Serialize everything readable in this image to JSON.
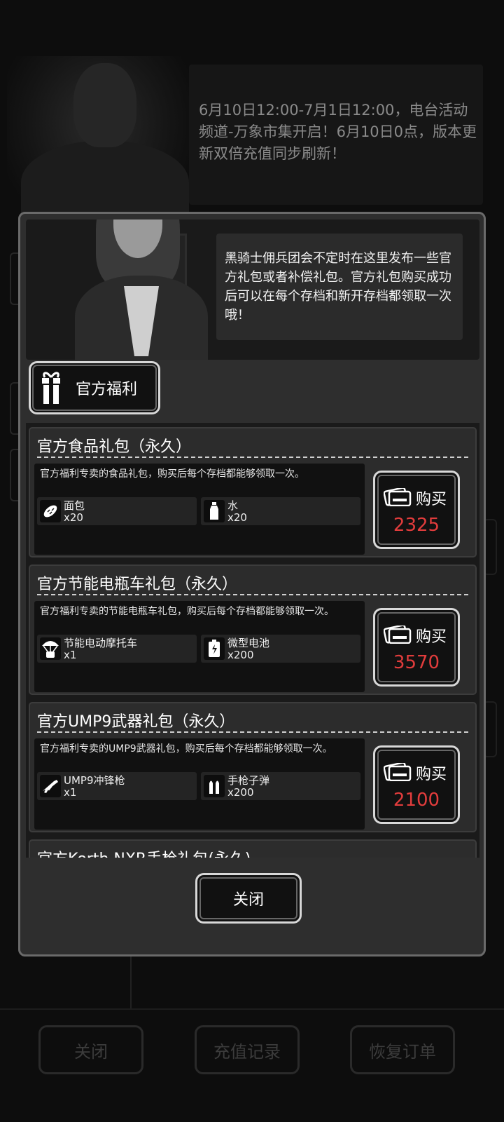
{
  "background": {
    "notice_text": "6月10日12:00-7月1日12:00，电台活动频道-万象市集开启！6月10日0点，版本更新双倍充值同步刷新！",
    "bottom_buttons": [
      {
        "label": "关闭"
      },
      {
        "label": "充值记录"
      },
      {
        "label": "恢复订单"
      }
    ]
  },
  "modal": {
    "intro_text": "黑骑士佣兵团会不定时在这里发布一些官方礼包或者补偿礼包。官方礼包购买成功后可以在每个存档和新开存档都领取一次哦！",
    "tab_label": "官方福利",
    "close_label": "关闭",
    "accent_price_color": "#e13c3c",
    "packs": [
      {
        "title": "官方食品礼包（永久）",
        "desc": "官方福利专卖的食品礼包，购买后每个存档都能够领取一次。",
        "buy_label": "购买",
        "price": "2325",
        "rewards": [
          {
            "icon": "bread-icon",
            "name": "面包",
            "count": "x20"
          },
          {
            "icon": "water-bottle-icon",
            "name": "水",
            "count": "x20"
          }
        ]
      },
      {
        "title": "官方节能电瓶车礼包（永久）",
        "desc": "官方福利专卖的节能电瓶车礼包，购买后每个存档都能够领取一次。",
        "buy_label": "购买",
        "price": "3570",
        "rewards": [
          {
            "icon": "airdrop-scooter-icon",
            "name": "节能电动摩托车",
            "count": "x1"
          },
          {
            "icon": "battery-icon",
            "name": "微型电池",
            "count": "x200"
          }
        ]
      },
      {
        "title": "官方UMP9武器礼包（永久）",
        "desc": "官方福利专卖的UMP9武器礼包，购买后每个存档都能够领取一次。",
        "buy_label": "购买",
        "price": "2100",
        "rewards": [
          {
            "icon": "smg-icon",
            "name": "UMP9冲锋枪",
            "count": "x1"
          },
          {
            "icon": "bullets-icon",
            "name": "手枪子弹",
            "count": "x200"
          }
        ]
      },
      {
        "title": "官方Korth NXR手枪礼包(永久)"
      }
    ]
  }
}
